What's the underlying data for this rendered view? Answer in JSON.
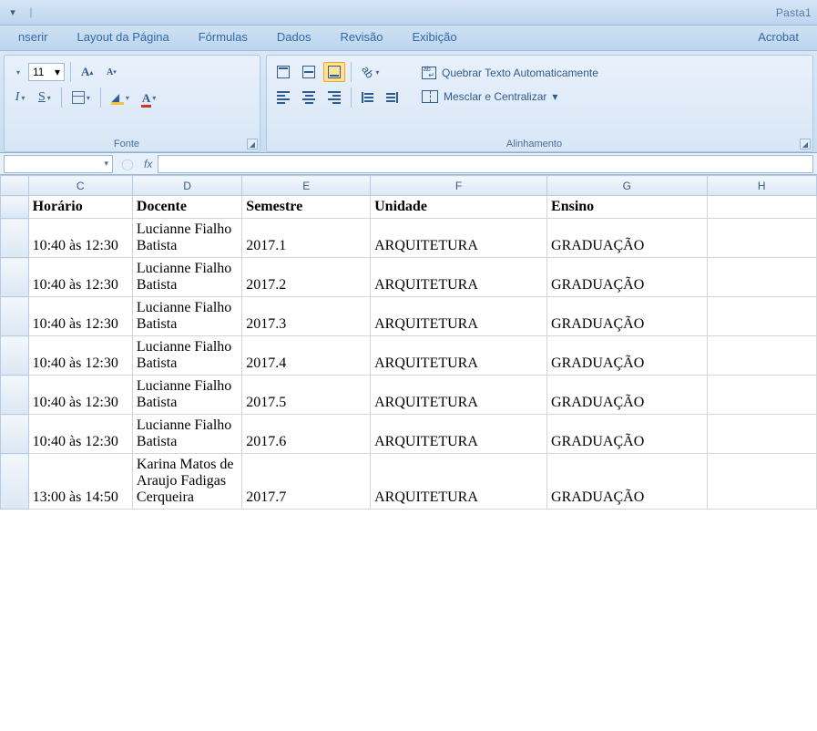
{
  "title_right": "Pasta1",
  "tabs": {
    "inserir": "nserir",
    "layout": "Layout da Página",
    "formulas": "Fórmulas",
    "dados": "Dados",
    "revisao": "Revisão",
    "exibicao": "Exibição",
    "acrobat": "Acrobat"
  },
  "ribbon": {
    "font": {
      "size_value": "11",
      "grow_label": "A",
      "shrink_label": "A",
      "underline_label": "S",
      "fontcolor_label": "A",
      "group_label": "Fonte"
    },
    "align": {
      "wrap_label": "Quebrar Texto Automaticamente",
      "merge_label": "Mesclar e Centralizar",
      "group_label": "Alinhamento"
    }
  },
  "formula_bar": {
    "name_box_value": "",
    "fx_label": "fx"
  },
  "columns": {
    "C": "C",
    "D": "D",
    "E": "E",
    "F": "F",
    "G": "G",
    "H": "H"
  },
  "headers": {
    "horario": "Horário",
    "docente": "Docente",
    "semestre": "Semestre",
    "unidade": "Unidade",
    "ensino": "Ensino"
  },
  "rows": [
    {
      "horario": "10:40 às 12:30",
      "docente": "Lucianne Fialho Batista",
      "semestre": "2017.1",
      "unidade": "ARQUITETURA",
      "ensino": "GRADUAÇÃO"
    },
    {
      "horario": "10:40 às 12:30",
      "docente": "Lucianne Fialho Batista",
      "semestre": "2017.2",
      "unidade": "ARQUITETURA",
      "ensino": "GRADUAÇÃO"
    },
    {
      "horario": "10:40 às 12:30",
      "docente": "Lucianne Fialho Batista",
      "semestre": "2017.3",
      "unidade": "ARQUITETURA",
      "ensino": "GRADUAÇÃO"
    },
    {
      "horario": "10:40 às 12:30",
      "docente": "Lucianne Fialho Batista",
      "semestre": "2017.4",
      "unidade": "ARQUITETURA",
      "ensino": "GRADUAÇÃO"
    },
    {
      "horario": "10:40 às 12:30",
      "docente": "Lucianne Fialho Batista",
      "semestre": "2017.5",
      "unidade": "ARQUITETURA",
      "ensino": "GRADUAÇÃO"
    },
    {
      "horario": "10:40 às 12:30",
      "docente": "Lucianne Fialho Batista",
      "semestre": "2017.6",
      "unidade": "ARQUITETURA",
      "ensino": "GRADUAÇÃO"
    },
    {
      "horario": "13:00 às 14:50",
      "docente": "Karina Matos de Araujo Fadigas Cerqueira",
      "semestre": "2017.7",
      "unidade": "ARQUITETURA",
      "ensino": "GRADUAÇÃO"
    }
  ]
}
